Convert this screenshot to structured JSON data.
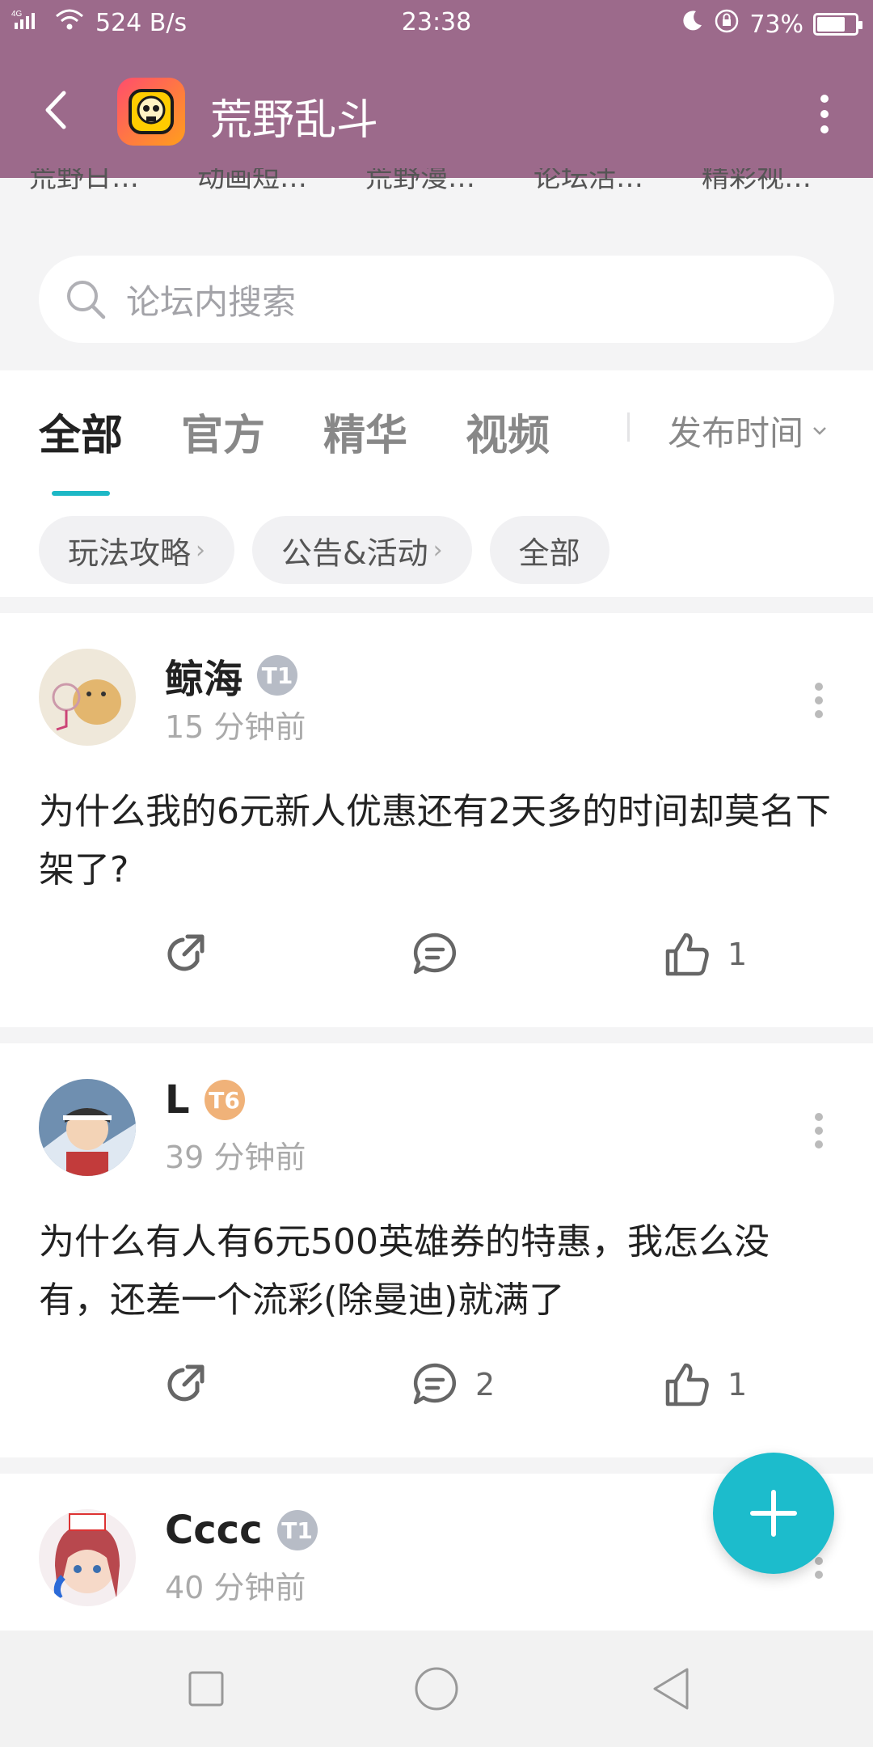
{
  "status_bar": {
    "network": "4G",
    "speed": "524 B/s",
    "time": "23:38",
    "battery": "73%",
    "battery_level": 0.73
  },
  "app_bar": {
    "title": "荒野乱斗",
    "logo_icon": "brawl-stars-skull-icon"
  },
  "shortcuts": [
    "荒野日…",
    "动画短…",
    "荒野漫…",
    "论坛活…",
    "精彩视…"
  ],
  "search": {
    "placeholder": "论坛内搜索"
  },
  "tabs": [
    {
      "label": "全部",
      "active": true
    },
    {
      "label": "官方",
      "active": false
    },
    {
      "label": "精华",
      "active": false
    },
    {
      "label": "视频",
      "active": false
    }
  ],
  "sort": {
    "label": "发布时间"
  },
  "chips": [
    {
      "label": "玩法攻略",
      "arrow": "›"
    },
    {
      "label": "公告&活动",
      "arrow": "›"
    },
    {
      "label": "全部",
      "arrow": ""
    }
  ],
  "posts": [
    {
      "user": "鲸海",
      "level": "T1",
      "level_color": "#b7bcc6",
      "time": "15 分钟前",
      "text": "为什么我的6元新人优惠还有2天多的时间却莫名下架了?",
      "comments": "",
      "likes": "1"
    },
    {
      "user": "L",
      "level": "T6",
      "level_color": "#f0b279",
      "time": "39 分钟前",
      "text": "为什么有人有6元500英雄券的特惠，我怎么没有，还差一个流彩(除曼迪)就满了",
      "comments": "2",
      "likes": "1"
    },
    {
      "user": "Cccc",
      "level": "T1",
      "level_color": "#b7bcc6",
      "time": "40 分钟前"
    }
  ],
  "colors": {
    "header": "#9c6a8b",
    "accent": "#1db8c6",
    "fab": "#1cbccc"
  }
}
